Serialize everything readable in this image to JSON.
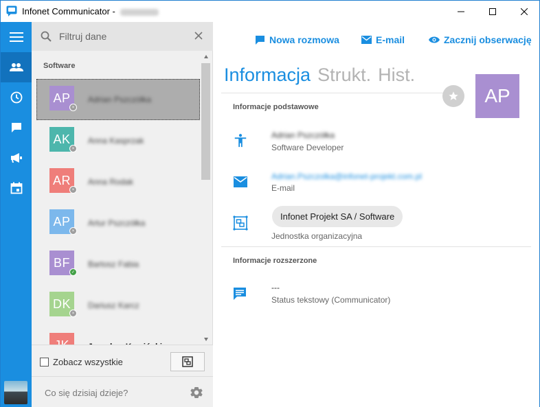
{
  "window": {
    "title": "Infonet Communicator -",
    "title_user": "Mikołaj Brucki"
  },
  "search": {
    "placeholder": "Filtruj dane"
  },
  "contacts": {
    "group_label": "Software",
    "items": [
      {
        "initials": "AP",
        "name": "Adrian Pszczółka",
        "color": "#a98fd1",
        "status": "offline"
      },
      {
        "initials": "AK",
        "name": "Anna Kasprzak",
        "color": "#4db6ac",
        "status": "offline"
      },
      {
        "initials": "AR",
        "name": "Anna Rodak",
        "color": "#ef7e7a",
        "status": "offline"
      },
      {
        "initials": "AP",
        "name": "Artur Pszczółka",
        "color": "#7cb8ec",
        "status": "offline"
      },
      {
        "initials": "BF",
        "name": "Bartosz Fabia",
        "color": "#a98fd1",
        "status": "online"
      },
      {
        "initials": "DK",
        "name": "Dariusz Karcz",
        "color": "#a5d48f",
        "status": "offline"
      },
      {
        "initials": "JK",
        "name": "Jarosław Kamiński",
        "color": "#ef7e7a",
        "status": "offline"
      }
    ],
    "see_all_label": "Zobacz wszystkie"
  },
  "status_bar": {
    "placeholder": "Co się dzisiaj dzieje?"
  },
  "actions": {
    "new_chat": "Nowa rozmowa",
    "email": "E-mail",
    "observe": "Zacznij obserwację"
  },
  "tabs": [
    "Informacja",
    "Strukt.",
    "Hist."
  ],
  "profile": {
    "initials": "AP",
    "avatar_color": "#a98fd1",
    "basic_title": "Informacje podstawowe",
    "name": "Adrian Pszczółka",
    "position": "Software Developer",
    "email": "Adrian.Pszczolka@infonet-projekt.com.pl",
    "email_label": "E-mail",
    "org_unit": "Infonet Projekt SA / Software",
    "org_unit_label": "Jednostka organizacyjna",
    "extended_title": "Informacje rozszerzone",
    "text_status": "---",
    "text_status_label": "Status tekstowy (Communicator)"
  },
  "colors": {
    "accent": "#1a8ee0",
    "rail": "#1a8ee0",
    "rail_active": "#1272bd"
  }
}
